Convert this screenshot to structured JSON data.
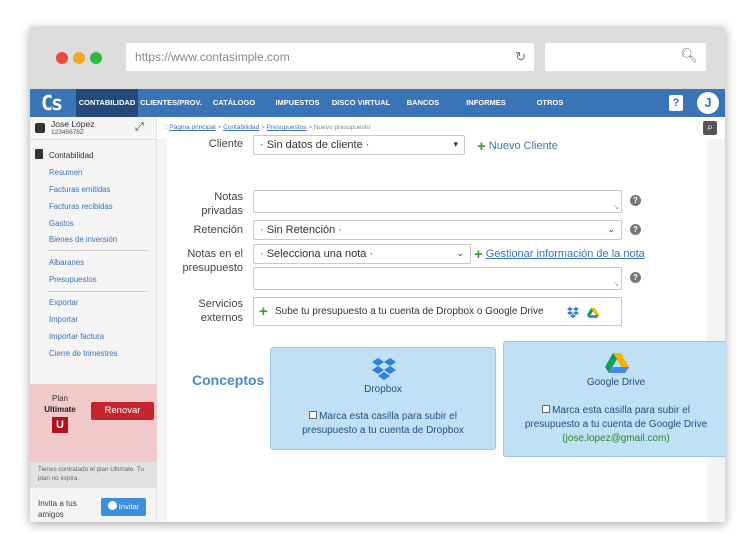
{
  "browser": {
    "url": "https://www.contasimple.com"
  },
  "nav": {
    "logo": "Cs",
    "items": [
      "CONTABILIDAD",
      "CLIENTES/PROV.",
      "CATÁLOGO",
      "IMPUESTOS",
      "DISCO VIRTUAL",
      "BANCOS",
      "INFORMES",
      "OTROS"
    ],
    "active": "CONTABILIDAD",
    "help": "?",
    "avatar_letter": "J",
    "accent_color": "#3b73b7"
  },
  "sidebar": {
    "user_name": "Jose López",
    "user_id": "12345678Z",
    "section": "Contabilidad",
    "group1": [
      "Resumen",
      "Facturas emitidas",
      "Facturas recibidas",
      "Gastos",
      "Bienes de inversión"
    ],
    "group2": [
      "Albaranes",
      "Presupuestos"
    ],
    "group3": [
      "Exportar",
      "Importar",
      "Importar factura",
      "Cierre de trimestres"
    ],
    "plan_label": "Plan",
    "plan_name": "Ultimate",
    "plan_badge": "U",
    "renew_label": "Renovar",
    "plan_note": "Tienes contratado el plan Ultimate. Tu plan no expira.",
    "invite_text": "Invita a tus amigos",
    "invite_button": "Invitar"
  },
  "breadcrumb": {
    "sep_prefix": ":: ",
    "items": [
      "Página principal",
      "Contabilidad",
      "Presupuestos"
    ],
    "current": "Nuevo presupuesto"
  },
  "form": {
    "cliente_label": "Cliente",
    "cliente_value": "· Sin datos de cliente ·",
    "nuevo_cliente": "Nuevo Cliente",
    "notas_privadas_label": "Notas privadas",
    "retencion_label": "Retención",
    "retencion_value": "· Sin Retención ·",
    "notas_presupuesto_label": "Notas en el presupuesto",
    "nota_select_value": "· Selecciona una nota ·",
    "gestionar_nota": "Gestionar información de la nota",
    "servicios_label": "Servicios externos",
    "servicios_prefix": "Sube tu presupuesto a tu cuenta de ",
    "servicios_dropbox": "Dropbox",
    "servicios_or": " o ",
    "servicios_gdrive": "Google Drive"
  },
  "cards": {
    "dropbox": {
      "title": "Dropbox",
      "text": "Marca esta casilla para subir el presupuesto a tu cuenta de Dropbox"
    },
    "gdrive": {
      "title": "Google Drive",
      "text": "Marca esta casilla para subir el presupuesto a tu cuenta de Google Drive",
      "email": "(jose.lopez@gmail.com)"
    }
  },
  "conceptos_title": "Conceptos"
}
